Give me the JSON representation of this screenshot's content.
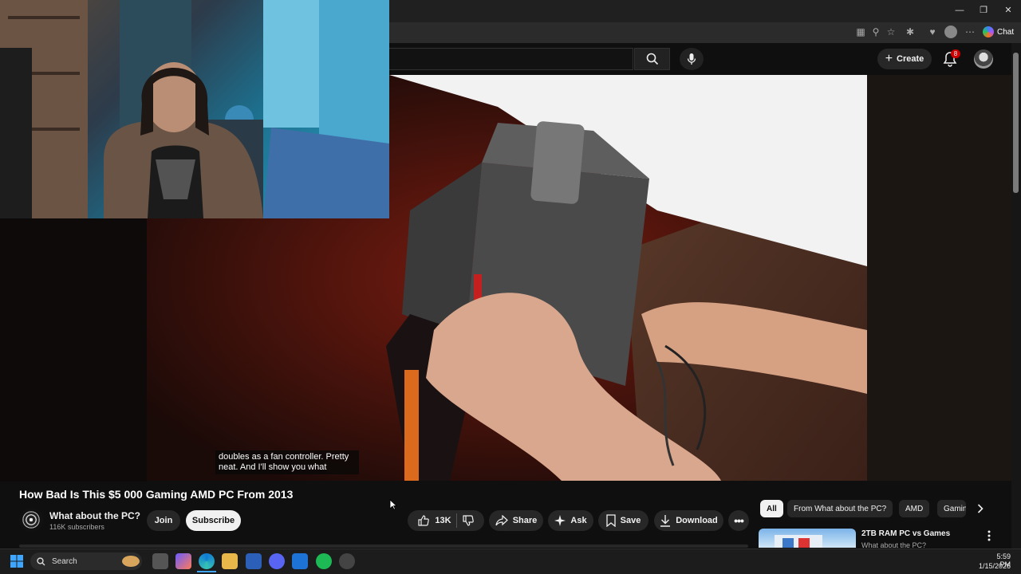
{
  "browser": {
    "chat_label": "Chat"
  },
  "header": {
    "create_label": "Create",
    "notification_count": "8"
  },
  "video": {
    "subtitle": "doubles as a fan controller. Pretty neat. And I'll show you what"
  },
  "meta": {
    "title": "How Bad Is This $5 000 Gaming AMD PC From 2013",
    "channel_name": "What about the PC?",
    "subscribers": "116K subscribers",
    "join_label": "Join",
    "subscribe_label": "Subscribe",
    "like_count": "13K",
    "share_label": "Share",
    "ask_label": "Ask",
    "save_label": "Save",
    "download_label": "Download"
  },
  "chips": [
    "All",
    "From What about the PC?",
    "AMD",
    "Gaming"
  ],
  "recommended": {
    "title": "2TB RAM PC vs Games",
    "channel": "What about the PC?"
  },
  "taskbar": {
    "search_label": "Search",
    "time": "5:59 PM",
    "date": "1/15/2026"
  },
  "colors": {
    "accent_red": "#cc0000",
    "background": "#0f0f0f",
    "pill": "#272727"
  }
}
